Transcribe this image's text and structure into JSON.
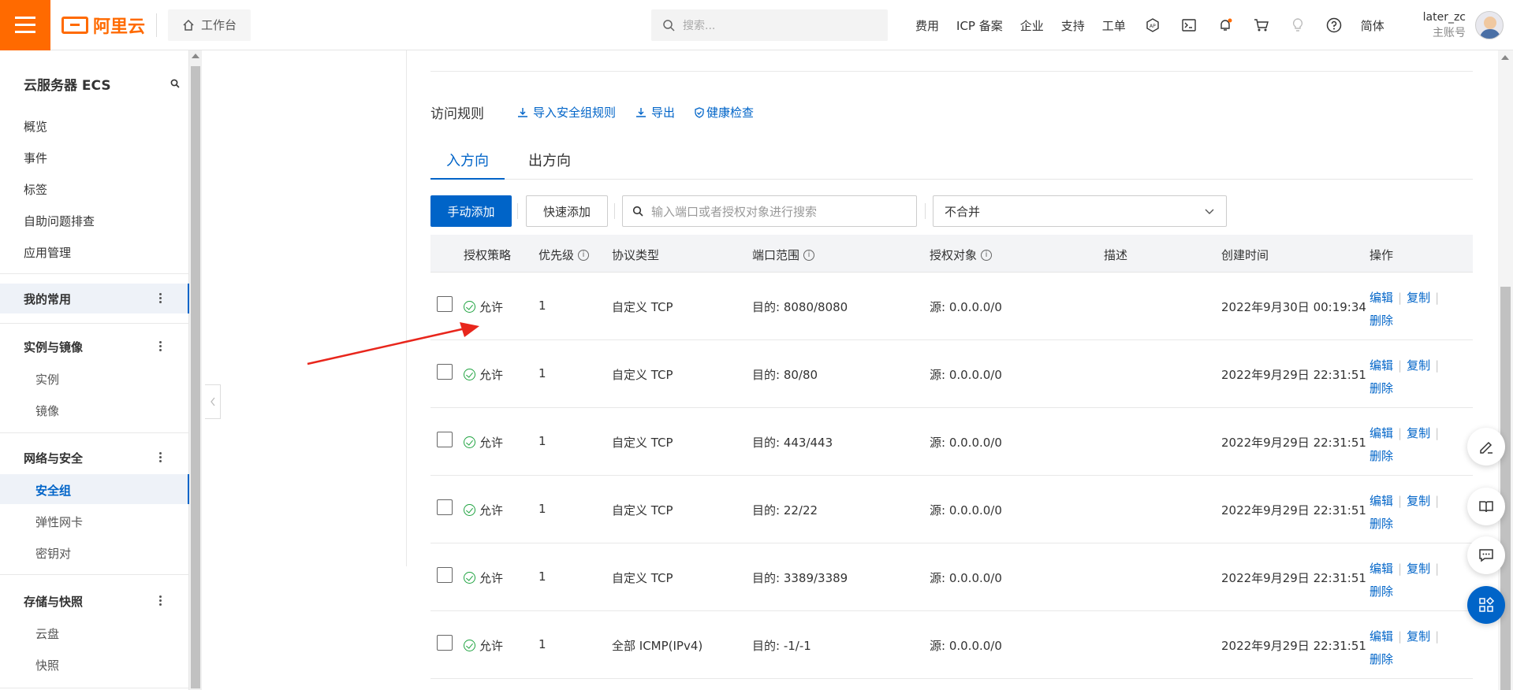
{
  "topbar": {
    "logo_text": "阿里云",
    "workbench": "工作台",
    "search_placeholder": "搜索...",
    "nav": [
      "费用",
      "ICP 备案",
      "企业",
      "支持",
      "工单"
    ],
    "lang": "简体",
    "user_name": "later_zc",
    "user_role": "主账号",
    "brand_color": "#ff6a00"
  },
  "sidebar": {
    "title": "云服务器 ECS",
    "top_items": [
      "概览",
      "事件",
      "标签",
      "自助问题排查",
      "应用管理"
    ],
    "group_favorites": "我的常用",
    "group_instances": "实例与镜像",
    "instances_items": [
      "实例",
      "镜像"
    ],
    "group_network": "网络与安全",
    "network_items": [
      "安全组",
      "弹性网卡",
      "密钥对"
    ],
    "group_storage": "存储与快照",
    "storage_items": [
      "云盘",
      "快照"
    ]
  },
  "main": {
    "rules_title": "访问规则",
    "import_link": "导入安全组规则",
    "export_link": "导出",
    "health_link": "健康检查",
    "tabs": [
      "入方向",
      "出方向"
    ],
    "add_button": "手动添加",
    "quick_add_button": "快速添加",
    "filter_placeholder": "输入端口或者授权对象进行搜索",
    "merge_select": "不合并",
    "accent_color": "#0064c8"
  },
  "table": {
    "headers": [
      "授权策略",
      "优先级",
      "协议类型",
      "端口范围",
      "授权对象",
      "描述",
      "创建时间",
      "操作"
    ],
    "rows": [
      {
        "policy": "允许",
        "priority": "1",
        "protocol": "自定义 TCP",
        "port": "目的: 8080/8080",
        "source": "源: 0.0.0.0/0",
        "desc": "",
        "created": "2022年9月30日 00:19:34"
      },
      {
        "policy": "允许",
        "priority": "1",
        "protocol": "自定义 TCP",
        "port": "目的: 80/80",
        "source": "源: 0.0.0.0/0",
        "desc": "",
        "created": "2022年9月29日 22:31:51"
      },
      {
        "policy": "允许",
        "priority": "1",
        "protocol": "自定义 TCP",
        "port": "目的: 443/443",
        "source": "源: 0.0.0.0/0",
        "desc": "",
        "created": "2022年9月29日 22:31:51"
      },
      {
        "policy": "允许",
        "priority": "1",
        "protocol": "自定义 TCP",
        "port": "目的: 22/22",
        "source": "源: 0.0.0.0/0",
        "desc": "",
        "created": "2022年9月29日 22:31:51"
      },
      {
        "policy": "允许",
        "priority": "1",
        "protocol": "自定义 TCP",
        "port": "目的: 3389/3389",
        "source": "源: 0.0.0.0/0",
        "desc": "",
        "created": "2022年9月29日 22:31:51"
      },
      {
        "policy": "允许",
        "priority": "1",
        "protocol": "全部 ICMP(IPv4)",
        "port": "目的: -1/-1",
        "source": "源: 0.0.0.0/0",
        "desc": "",
        "created": "2022年9月29日 22:31:51"
      }
    ],
    "ops": {
      "edit": "编辑",
      "copy": "复制",
      "delete": "删除"
    }
  }
}
